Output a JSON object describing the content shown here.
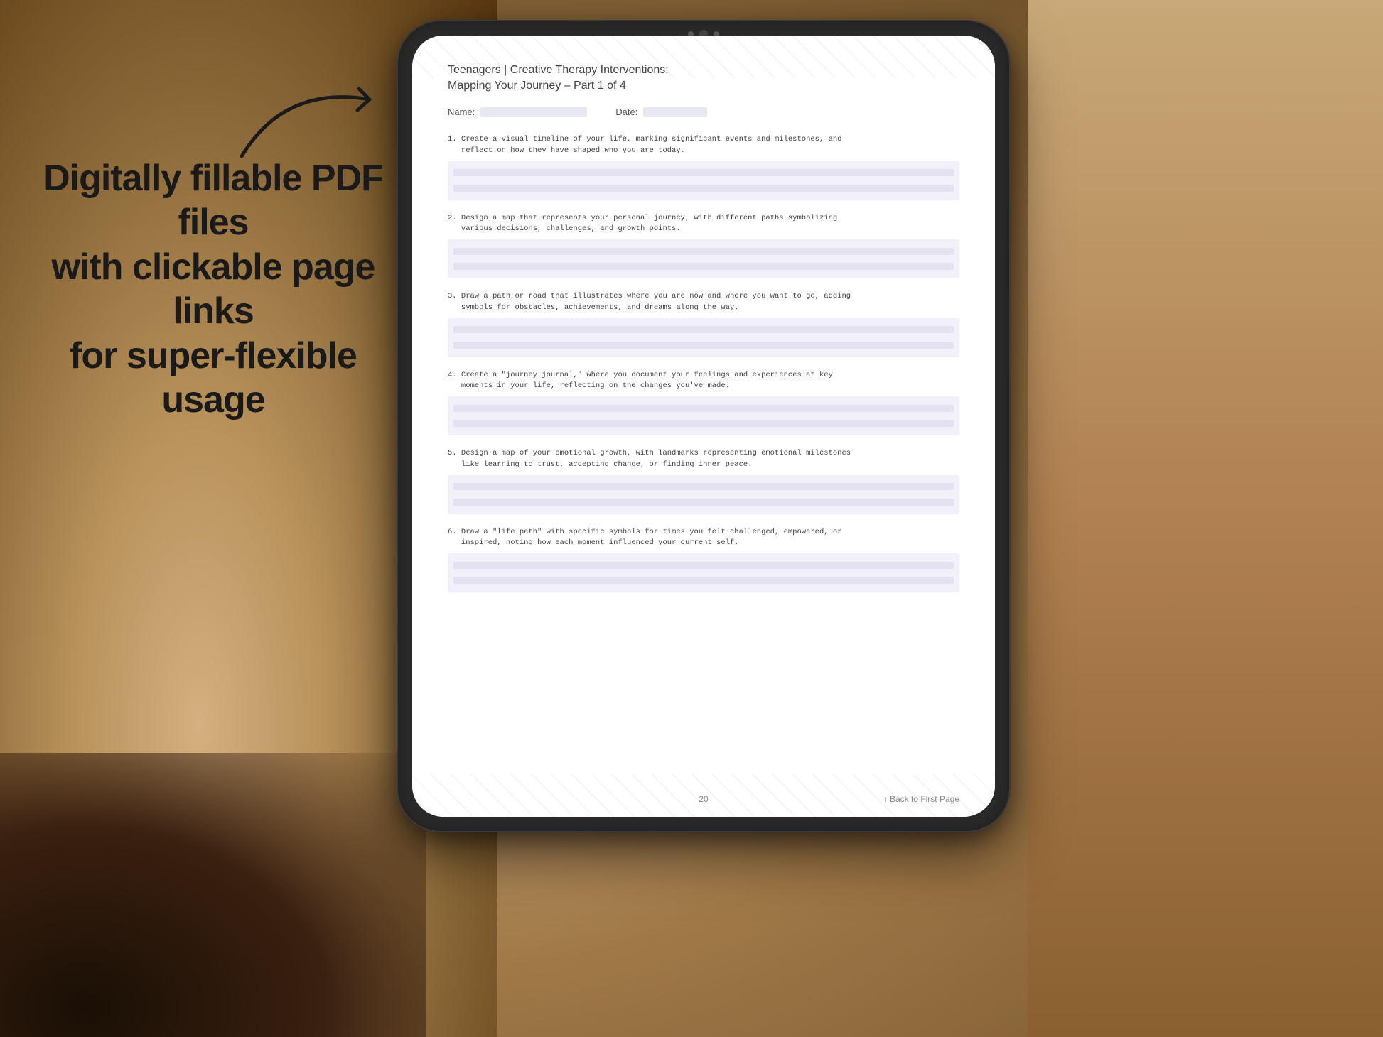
{
  "background": {
    "color_left": "#b8956a",
    "color_right": "#c8a878"
  },
  "promo": {
    "line1": "Digitally fillable PDF files",
    "line2": "with clickable page links",
    "line3": "for super-flexible usage"
  },
  "arrow": {
    "label": "arrow pointing right to tablet"
  },
  "tablet": {
    "camera_dots": 3
  },
  "pdf": {
    "title_main": "Teenagers | Creative Therapy Interventions:",
    "title_sub": "Mapping Your Journey  – Part 1 of 4",
    "name_label": "Name:",
    "date_label": "Date:",
    "questions": [
      {
        "number": "1.",
        "text": "Create a visual timeline of your life, marking significant events and milestones, and\nreflect on how they have shaped who you are today."
      },
      {
        "number": "2.",
        "text": "Design a map that represents your personal journey, with different paths symbolizing\nvarious decisions, challenges, and growth points."
      },
      {
        "number": "3.",
        "text": "Draw a path or road that illustrates where you are now and where you want to go, adding\nsymbols for obstacles, achievements, and dreams along the way."
      },
      {
        "number": "4.",
        "text": "Create a \"journey journal,\" where you document your feelings and experiences at key\nmoments in your life, reflecting on the changes you've made."
      },
      {
        "number": "5.",
        "text": "Design a map of your emotional growth, with landmarks representing emotional milestones\nlike learning to trust, accepting change, or finding inner peace."
      },
      {
        "number": "6.",
        "text": "Draw a \"life path\" with specific symbols for times you felt challenged, empowered, or\ninspired, noting how each moment influenced your current self."
      }
    ],
    "page_number": "20",
    "back_link": "↑ Back to First Page"
  }
}
